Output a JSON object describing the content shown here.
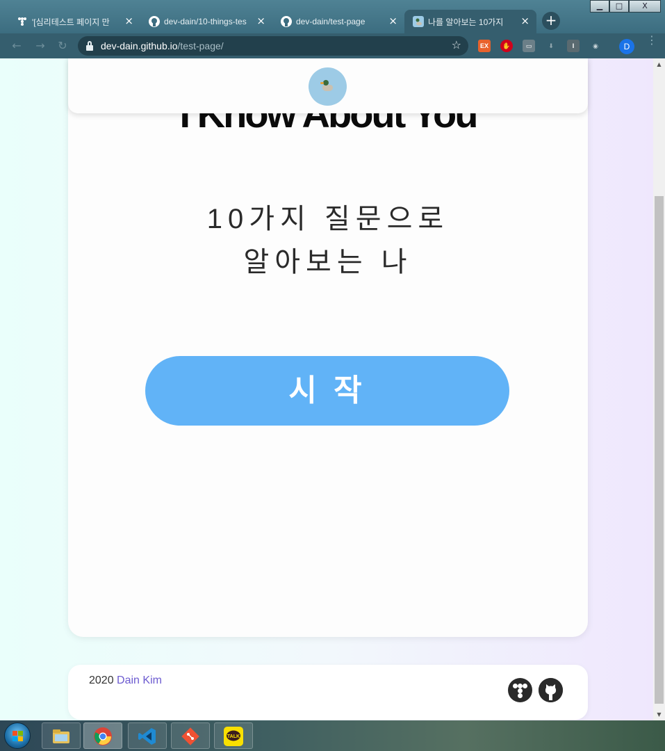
{
  "window": {
    "controls": {
      "minimize": "▁",
      "maximize": "□",
      "close": "X"
    }
  },
  "tabs": [
    {
      "label": "'[심리테스트 페이지 만",
      "close": "×",
      "icon": "tumblbug-favicon"
    },
    {
      "label": "dev-dain/10-things-tes",
      "close": "×",
      "icon": "github-favicon"
    },
    {
      "label": "dev-dain/test-page",
      "close": "×",
      "icon": "github-favicon"
    },
    {
      "label": "나를 알아보는 10가지",
      "close": "×",
      "icon": "duck-favicon",
      "active": true
    }
  ],
  "new_tab_label": "+",
  "toolbar": {
    "back": "←",
    "forward": "→",
    "reload": "↻",
    "url_host": "dev-dain.github.io",
    "url_path": "/test-page/",
    "bookmark": "☆",
    "extensions": [
      {
        "name": "extension-ex",
        "label": "EX",
        "color": "#e8622c"
      },
      {
        "name": "extension-stop",
        "label": "✋",
        "color": "#d0021b"
      },
      {
        "name": "extension-screen",
        "label": "▭",
        "color": "#6b7f88"
      },
      {
        "name": "extension-download",
        "label": "⬇",
        "color": "#6b7f88"
      },
      {
        "name": "extension-i",
        "label": "I",
        "color": "#5a6a70"
      },
      {
        "name": "extension-camera",
        "label": "◉",
        "color": "#5a6a70"
      }
    ],
    "profile_initial": "D"
  },
  "page": {
    "headline": "I Know About You",
    "subtitle_line1": "10가지 질문으로",
    "subtitle_line2": "알아보는 나",
    "start_button": "시 작",
    "footer": {
      "year": "2020",
      "author": "Dain Kim"
    },
    "accent": "#61b3f7",
    "author_color": "#6c5bd0"
  },
  "taskbar": {
    "items": [
      "file-explorer",
      "chrome",
      "vscode",
      "git",
      "kakaotalk"
    ],
    "kakao_label": "TALK"
  }
}
